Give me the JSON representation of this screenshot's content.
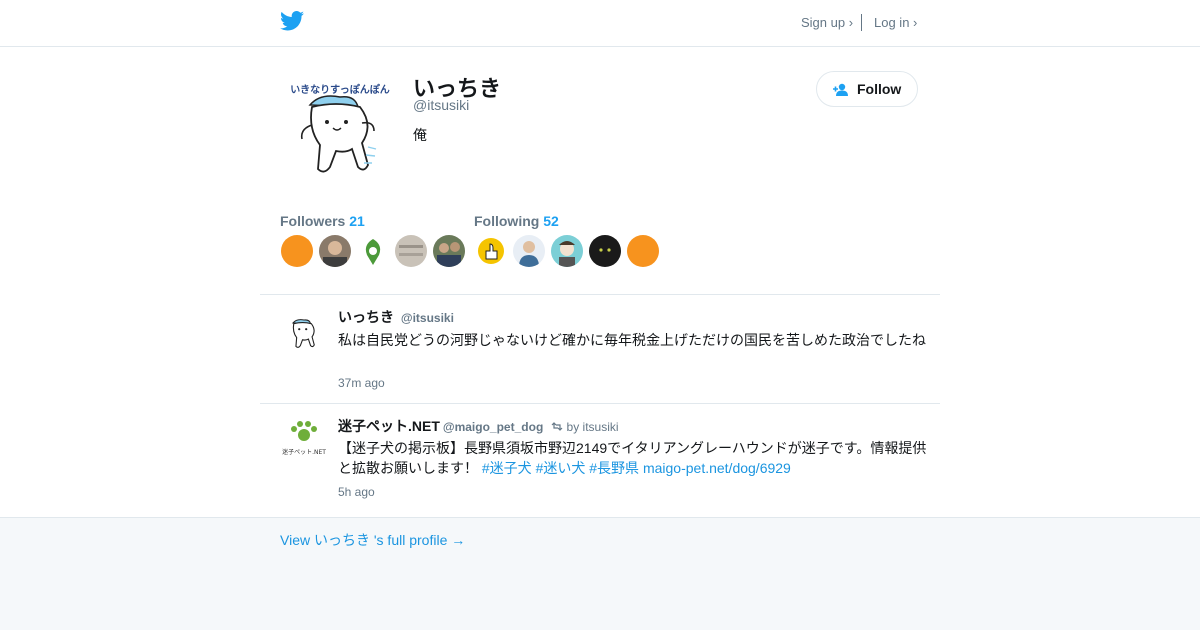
{
  "header": {
    "signup_label": "Sign up ›",
    "login_label": "Log in ›",
    "logo_icon": "twitter-bird-icon",
    "brand_color": "#1da1f2"
  },
  "profile": {
    "display_name": "いっちき",
    "display_name_emoji": "",
    "handle": "@itsusiki",
    "bio": "俺",
    "avatar_caption": "いきなりすっぽんぽん",
    "follow_label": "Follow",
    "followers_label": "Followers",
    "followers_count": "21",
    "following_label": "Following",
    "following_count": "52"
  },
  "followers_avatars": [
    {
      "kind": "orange",
      "color": "#f7931e"
    },
    {
      "kind": "photo-man",
      "color": "#8a7a6a"
    },
    {
      "kind": "green-sketch",
      "color": "#4c9a3a"
    },
    {
      "kind": "photo-gray",
      "color": "#c9c2b8"
    },
    {
      "kind": "photo-people",
      "color": "#6a7a5a"
    }
  ],
  "following_avatars": [
    {
      "kind": "thumbs-up",
      "color": "#f5c400"
    },
    {
      "kind": "person-blue",
      "color": "#3f6e99"
    },
    {
      "kind": "illustration",
      "color": "#7ccfd6"
    },
    {
      "kind": "black-cat",
      "color": "#1a1a1a"
    },
    {
      "kind": "orange",
      "color": "#f7931e"
    }
  ],
  "tweets": [
    {
      "name": "いっちき",
      "name_emoji": "",
      "handle": "@itsusiki",
      "retweet_by": "",
      "text": "私は自民党どうの河野じゃないけど確かに毎年税金上げただけの国民を苦しめた政治でしたね",
      "text_emoji": "",
      "hashtags": [],
      "link": "",
      "time": "37m ago"
    },
    {
      "name": "迷子ペット.NET",
      "handle": "@maigo_pet_dog",
      "retweet_by": "by itsusiki",
      "text": "【迷子犬の掲示板】長野県須坂市野辺2149でイタリアングレーハウンドが迷子です。情報提供と拡散お願いします！",
      "hashtags": [
        "#迷子犬",
        "#迷い犬",
        "#長野県"
      ],
      "link": "maigo-pet.net/dog/6929",
      "avatar_caption": "迷子ペット.NET",
      "time": "5h ago"
    }
  ],
  "footer": {
    "full_profile_link": "View いっちき 's full profile →"
  }
}
